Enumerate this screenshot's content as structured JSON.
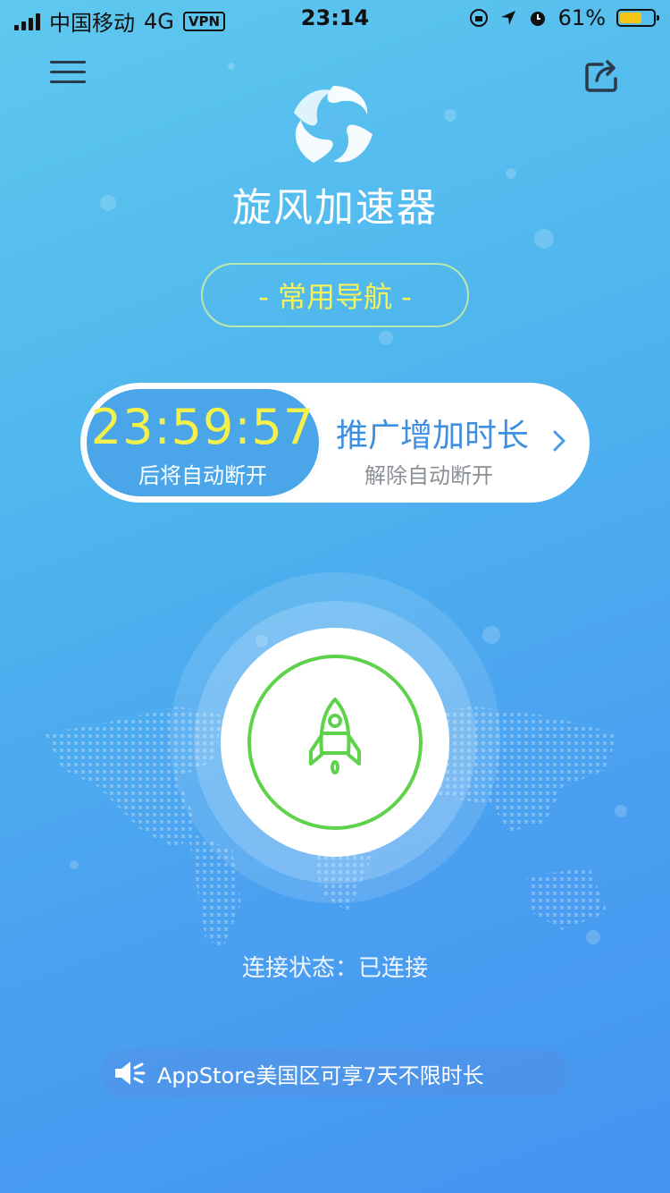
{
  "status_bar": {
    "carrier": "中国移动",
    "network": "4G",
    "vpn": "VPN",
    "time": "23:14",
    "battery_percent": "61%"
  },
  "header": {
    "menu_icon": "hamburger-menu-icon",
    "share_icon": "share-icon",
    "logo_icon": "whirlwind-logo-icon",
    "app_title": "旋风加速器"
  },
  "nav": {
    "label": "- 常用导航 -"
  },
  "timer": {
    "countdown": "23:59:57",
    "countdown_caption": "后将自动断开",
    "promo_title": "推广增加时长",
    "promo_caption": "解除自动断开",
    "chevron_icon": "chevron-right-icon"
  },
  "connect": {
    "icon": "rocket-icon",
    "status_label": "连接状态：已连接"
  },
  "notice": {
    "icon": "speaker-icon",
    "text": "AppStore美国区可享7天不限时长"
  },
  "colors": {
    "accent_yellow": "#f3f04c",
    "connected_green": "#5fd24b",
    "promo_blue": "#3e8fe0"
  }
}
